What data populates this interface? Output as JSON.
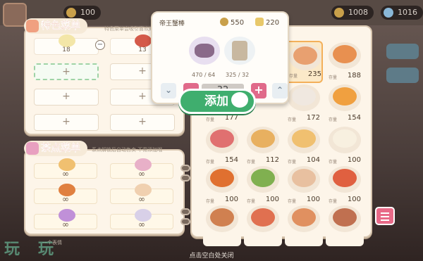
{
  "background": {
    "currency_left": "100",
    "currency_right": "1008",
    "currency_far": "1016"
  },
  "special_menu": {
    "title": "特色菜单",
    "subtitle": "特色菜单会吸引喜欢的客",
    "slots": [
      {
        "type": "filled",
        "count": "18",
        "color": "#f3e6a8"
      },
      {
        "type": "filled",
        "count": "13",
        "color": "#d45a4a"
      },
      {
        "type": "empty_active",
        "label": "+"
      },
      {
        "type": "empty",
        "label": "+"
      },
      {
        "type": "empty",
        "label": "+"
      },
      {
        "type": "empty",
        "label": "+"
      },
      {
        "type": "empty",
        "label": "+"
      },
      {
        "type": "empty",
        "label": "+"
      }
    ],
    "remove_label": "−"
  },
  "tea_menu": {
    "title": "茶点菜单",
    "subtitle": "系点解锁后自动售卖 不需添加哦",
    "slots": [
      {
        "count": "∞",
        "color": "#f0c070"
      },
      {
        "count": "∞",
        "color": "#e8b0c8"
      },
      {
        "count": "∞",
        "color": "#e08040"
      },
      {
        "count": "∞",
        "color": "#f0d0b0"
      },
      {
        "count": "∞",
        "color": "#c090d8"
      },
      {
        "count": "∞",
        "color": "#d8d0e8"
      }
    ]
  },
  "popup": {
    "dish_name": "帝王蟹棒",
    "coin_cost": "550",
    "star_cost": "220",
    "coin_color": "#c9a04a",
    "star_color": "#e8c86a",
    "ingredients": [
      {
        "count": "470 / 64",
        "color": "#8a6a8a"
      },
      {
        "count": "325 / 32",
        "color": "#c8b8a0"
      }
    ],
    "quantity": "32",
    "minus_label": "−",
    "plus_label": "+",
    "min_label": "⌄",
    "max_label": "⌃",
    "add_label": "添加"
  },
  "dish_grid": {
    "stock_label": "存量",
    "dishes": [
      {
        "stock": "235",
        "color": "#e8a070",
        "selected": true
      },
      {
        "stock": "188",
        "color": "#e89050",
        "selected": false
      },
      {
        "stock": "177",
        "color": "#e0c080",
        "selected": false
      },
      {
        "stock": "172",
        "color": "#f0e8e0",
        "selected": false
      },
      {
        "stock": "154",
        "color": "#f0a040",
        "selected": false
      },
      {
        "stock": "154",
        "color": "#e07070",
        "selected": false
      },
      {
        "stock": "112",
        "color": "#e8b060",
        "selected": false
      },
      {
        "stock": "104",
        "color": "#f0c070",
        "selected": false
      },
      {
        "stock": "100",
        "color": "#f8f0e0",
        "selected": false
      },
      {
        "stock": "100",
        "color": "#e07030",
        "selected": false
      },
      {
        "stock": "100",
        "color": "#80b050",
        "selected": false
      },
      {
        "stock": "100",
        "color": "#e8c0a0",
        "selected": false
      },
      {
        "stock": "100",
        "color": "#e06040",
        "selected": false
      },
      {
        "stock": "",
        "color": "#d08050",
        "selected": false
      },
      {
        "stock": "",
        "color": "#e07050",
        "selected": false
      },
      {
        "stock": "",
        "color": "#e09060",
        "selected": false
      },
      {
        "stock": "",
        "color": "#c07050",
        "selected": false
      }
    ]
  },
  "hint": "点击空白处关闭",
  "chat_line": "一个表情",
  "watermark": "玩玩"
}
